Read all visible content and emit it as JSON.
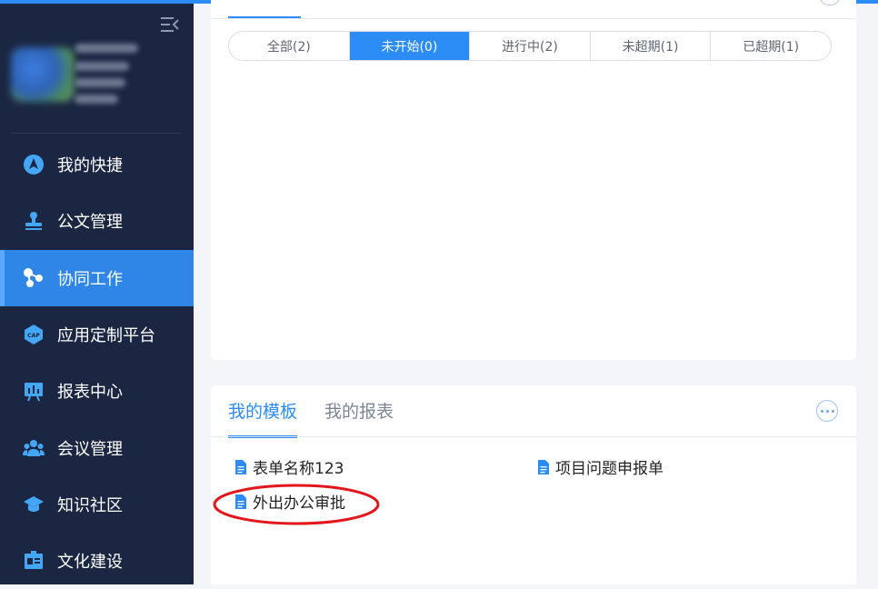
{
  "sidebar": {
    "menu": [
      {
        "label": "我的快捷",
        "icon": "navigation-icon"
      },
      {
        "label": "公文管理",
        "icon": "stamp-icon"
      },
      {
        "label": "协同工作",
        "icon": "collaboration-icon",
        "active": true
      },
      {
        "label": "应用定制平台",
        "icon": "cap-icon"
      },
      {
        "label": "报表中心",
        "icon": "report-board-icon"
      },
      {
        "label": "会议管理",
        "icon": "meeting-people-icon"
      },
      {
        "label": "知识社区",
        "icon": "graduation-cap-icon"
      },
      {
        "label": "文化建设",
        "icon": "culture-board-icon"
      }
    ]
  },
  "status_tabs": [
    "全部(2)",
    "未开始(0)",
    "进行中(2)",
    "未超期(1)",
    "已超期(1)"
  ],
  "status_active": "未开始(0)",
  "bottom": {
    "tabs": [
      "我的模板",
      "我的报表"
    ],
    "active_tab": "我的模板",
    "templates": [
      "表单名称123",
      "项目问题申报单",
      "外出办公审批"
    ]
  },
  "colors": {
    "accent": "#2b8cf5",
    "sidebar": "#1b2642",
    "annotation": "#e3161b"
  }
}
